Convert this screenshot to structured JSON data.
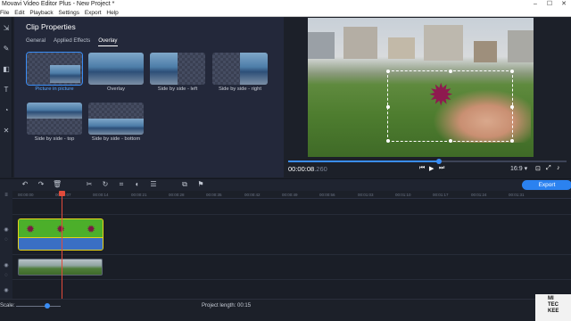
{
  "window": {
    "title": "Movavi Video Editor Plus - New Project *",
    "controls": [
      "–",
      "☐",
      "✕"
    ]
  },
  "menu": [
    "File",
    "Edit",
    "Playback",
    "Settings",
    "Export",
    "Help"
  ],
  "panel": {
    "title": "Clip Properties",
    "tabs": [
      {
        "label": "General",
        "active": false
      },
      {
        "label": "Applied Effects",
        "active": false
      },
      {
        "label": "Overlay",
        "active": true
      }
    ],
    "overlay_options": [
      {
        "label": "Picture in picture",
        "selected": true
      },
      {
        "label": "Overlay",
        "selected": false
      },
      {
        "label": "Side by side - left",
        "selected": false
      },
      {
        "label": "Side by side - right",
        "selected": false
      },
      {
        "label": "Side by side - top",
        "selected": false
      },
      {
        "label": "Side by side - bottom",
        "selected": false
      }
    ]
  },
  "player": {
    "timecode_main": "00:00:08",
    "timecode_frac": ".260",
    "playback_progress": 0.54,
    "aspect": "16:9 ▾"
  },
  "toolbar": {
    "export_label": "Export"
  },
  "ruler_ticks": [
    "00:00:00",
    "00:00:07",
    "00:00:14",
    "00:00:21",
    "00:00:28",
    "00:00:35",
    "00:00:42",
    "00:00:49",
    "00:00:56",
    "00:01:03",
    "00:01:10",
    "00:01:17",
    "00:01:24",
    "00:01:31"
  ],
  "footer": {
    "scale_label": "Scale:",
    "project_length": "Project length:  00:15"
  },
  "watermark": {
    "line1": "MI",
    "line2": "TEC",
    "line3": "KEE"
  },
  "colors": {
    "accent": "#3a8df5",
    "playhead": "#e24b3b",
    "clip_border": "#e6d21a"
  }
}
